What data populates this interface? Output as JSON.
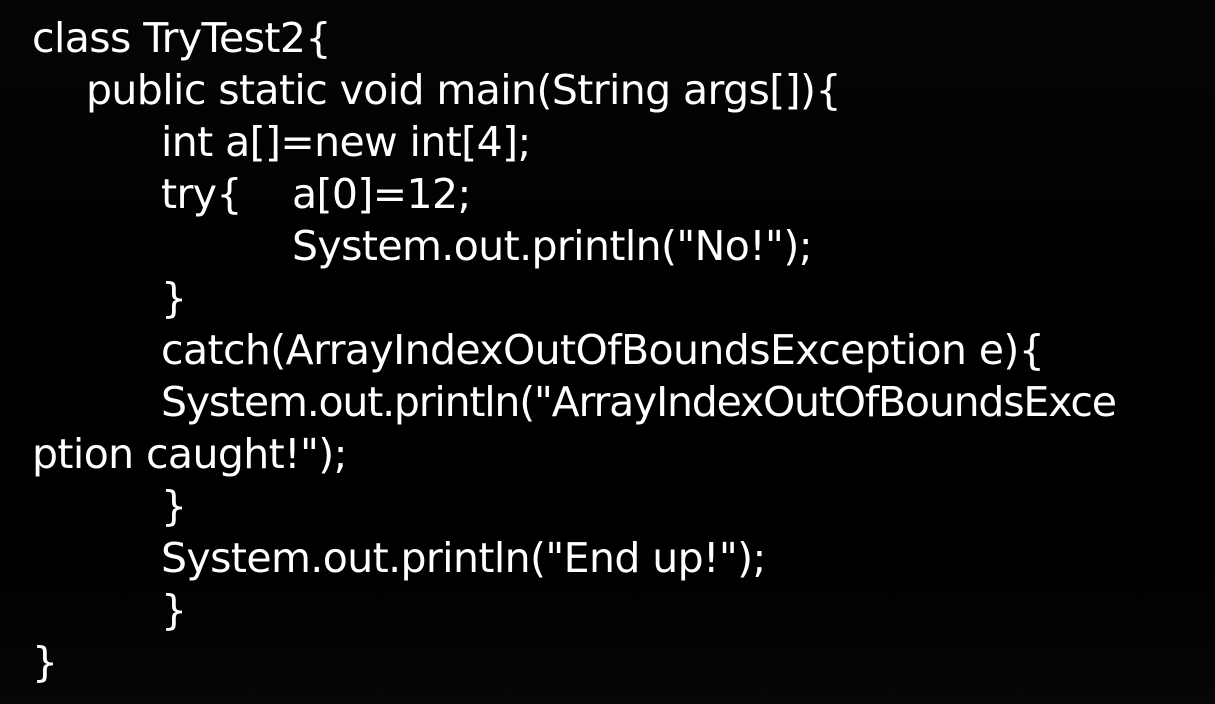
{
  "slide": {
    "code_lines": [
      "class TryTest2{",
      "public static void main(String args[]){",
      "int a[]=new int[4];",
      "try{",
      "a[0]=12;",
      "System.out.println(\"No!\");",
      "}",
      "catch(ArrayIndexOutOfBoundsException e){",
      "System.out.println(\"ArrayIndexOutOfBoundsExce",
      "ption caught!\");",
      "}",
      "System.out.println(\"End up!\");",
      "}",
      "}"
    ],
    "colors": {
      "background": "#000000",
      "text": "#ffffff"
    }
  }
}
